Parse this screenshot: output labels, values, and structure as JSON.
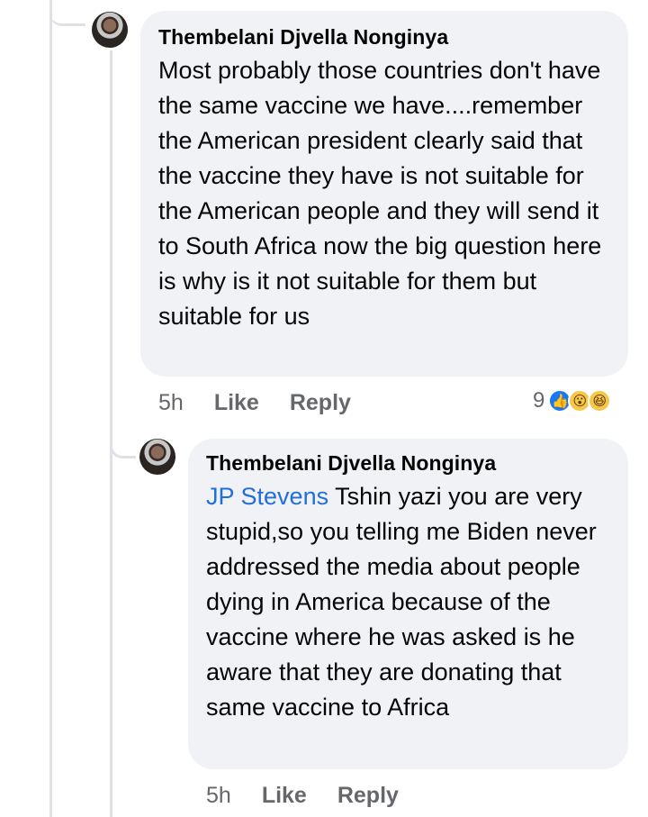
{
  "comment": {
    "author": "Thembelani Djvella Nonginya",
    "text": "Most probably those countries don't have the same vaccine we have....remember the American president clearly said that the vaccine they have is not suitable for the American people and they will send it to South Africa now the big question here is why is it not suitable for them but suitable for us",
    "time": "5h",
    "like_label": "Like",
    "reply_label": "Reply",
    "reaction_count": "9",
    "reactions": [
      "like-icon",
      "wow-icon",
      "haha-icon"
    ]
  },
  "reply": {
    "author": "Thembelani Djvella Nonginya",
    "mention": "JP Stevens",
    "text": " Tshin yazi you are very stupid,so you telling me Biden never addressed the media about people dying in America because of the vaccine where he was asked is he aware that they are donating that same vaccine to Africa",
    "time": "5h",
    "like_label": "Like",
    "reply_label": "Reply"
  },
  "colors": {
    "bubble": "#f0f2f5",
    "mention": "#216fdb",
    "meta": "#65676b",
    "like_blue": "#1877f2",
    "emoji_yellow": "#f7c74a"
  }
}
